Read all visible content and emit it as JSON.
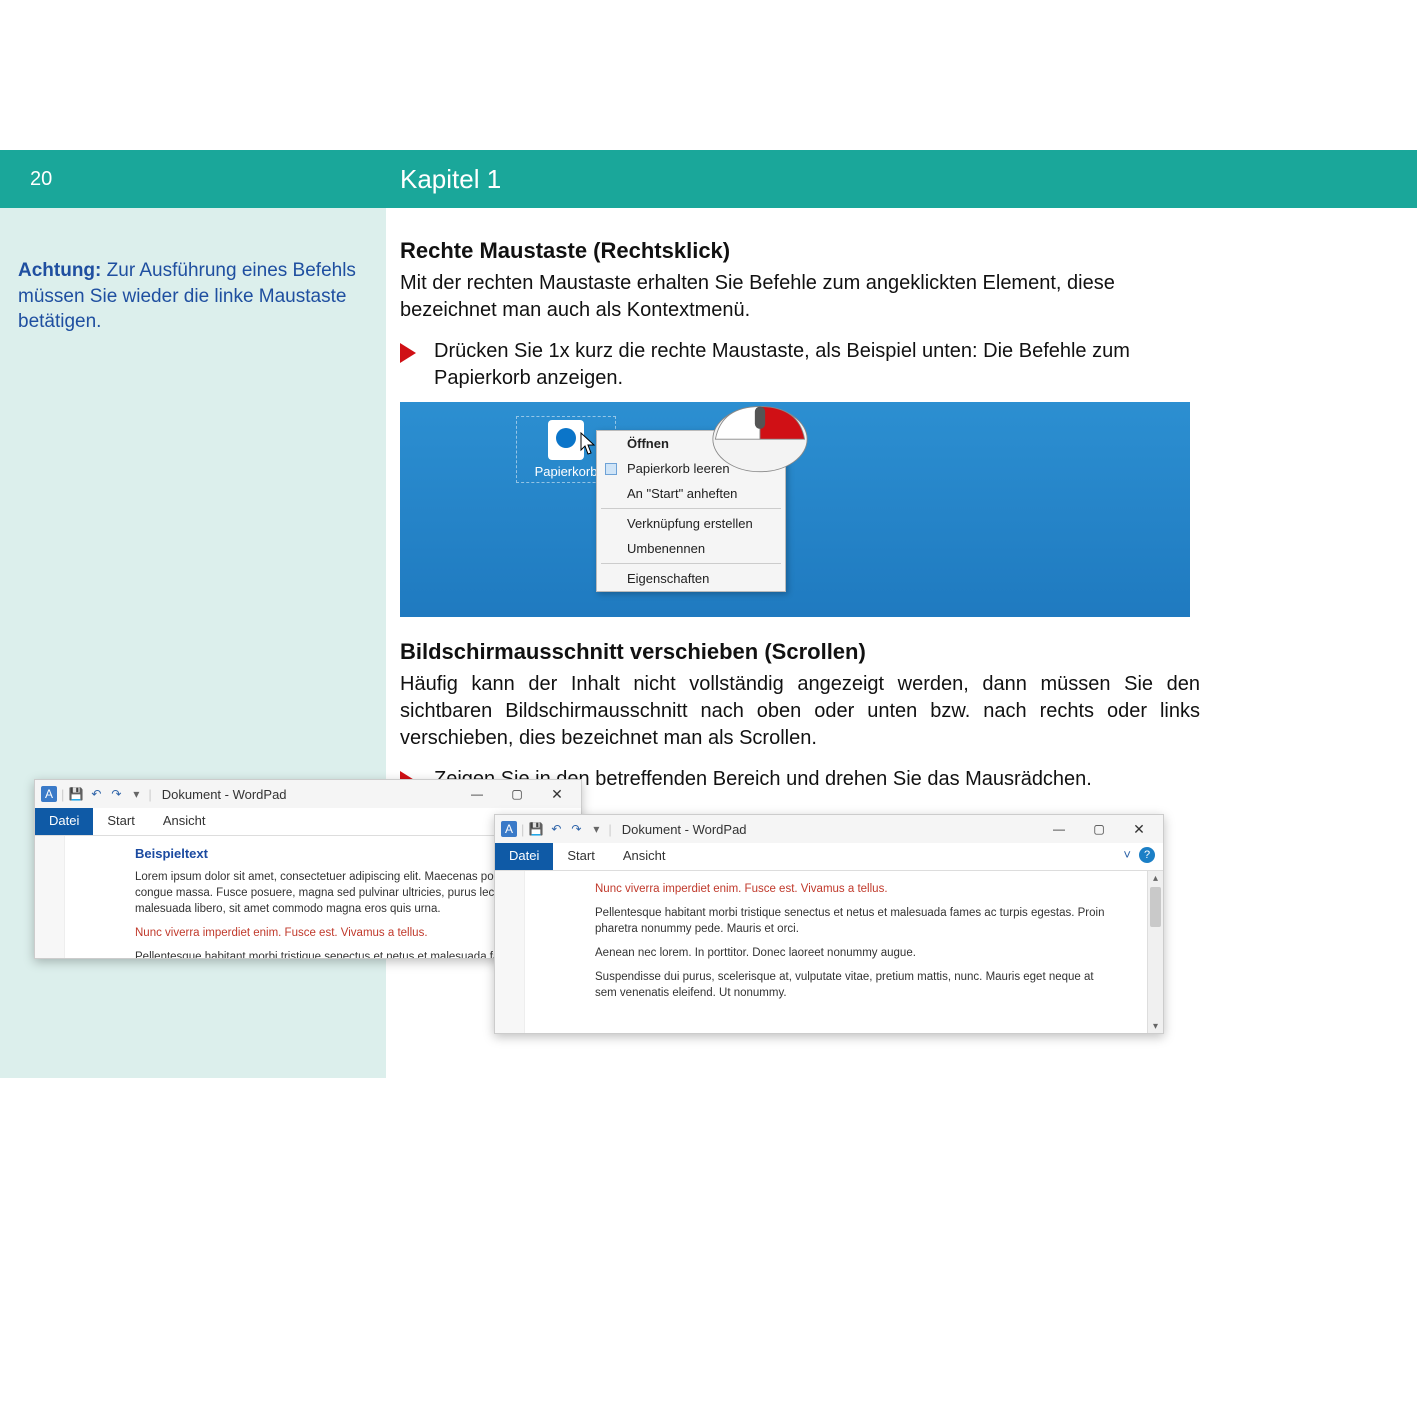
{
  "header": {
    "page_number": "20",
    "chapter_title": "Kapitel 1"
  },
  "sidebar": {
    "note_bold": "Achtung:",
    "note_text": " Zur Ausführung eines Befehls müssen Sie wieder die linke Maustaste betätigen."
  },
  "section1": {
    "heading": "Rechte Maustaste (Rechtsklick)",
    "intro": "Mit der rechten Maustaste erhalten Sie Befehle zum angeklickten Element, diese bezeichnet man auch als Kontextmenü.",
    "bullet": "Drücken Sie 1x kurz die rechte Maustaste, als Beispiel unten: Die Befehle zum Papierkorb anzeigen."
  },
  "desktop": {
    "icon_label": "Papierkorb",
    "context_menu": {
      "open": "Öffnen",
      "empty": "Papierkorb leeren",
      "pin": "An \"Start\" anheften",
      "shortcut": "Verknüpfung erstellen",
      "rename": "Umbenennen",
      "properties": "Eigenschaften"
    }
  },
  "section2": {
    "heading": "Bildschirmausschnitt verschieben (Scrollen)",
    "intro": "Häufig kann der Inhalt nicht vollständig angezeigt werden, dann müssen Sie den sichtbaren Bildschirmausschnitt nach oben oder unten bzw. nach rechts oder links verschieben, dies bezeichnet man als Scrollen.",
    "bullet": "Zeigen Sie in den betreffenden Bereich und drehen Sie das Mausrädchen."
  },
  "wordpad": {
    "title": "Dokument - WordPad",
    "tabs": {
      "datei": "Datei",
      "start": "Start",
      "ansicht": "Ansicht"
    },
    "win": {
      "min": "—",
      "max": "▢",
      "close": "✕",
      "chev": "˅",
      "help": "?"
    },
    "doc1": {
      "heading": "Beispieltext",
      "p1": "Lorem ipsum dolor sit amet, consectetuer adipiscing elit. Maecenas porttitor congue massa. Fusce posuere, magna sed pulvinar ultricies, purus lectus malesuada libero, sit amet commodo magna eros quis urna.",
      "red": "Nunc viverra imperdiet enim. Fusce est. Vivamus a tellus.",
      "p2": "Pellentesque habitant morbi tristique senectus et netus et malesuada fames ac turpis egestas. Proin pharetra nonummy pede. Mauris et orci."
    },
    "doc2": {
      "red": "Nunc viverra imperdiet enim. Fusce est. Vivamus a tellus.",
      "p1": "Pellentesque habitant morbi tristique senectus et netus et malesuada fames ac turpis egestas. Proin pharetra nonummy pede. Mauris et orci.",
      "p2": "Aenean nec lorem. In porttitor. Donec laoreet nonummy augue.",
      "p3": "Suspendisse dui purus, scelerisque at, vulputate vitae, pretium mattis, nunc. Mauris eget neque at sem venenatis eleifend. Ut nonummy."
    }
  }
}
